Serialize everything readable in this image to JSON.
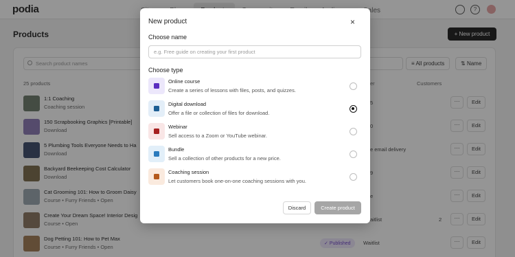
{
  "app": {
    "logo": "podia",
    "nav": [
      "Sites",
      "Plans",
      "Products",
      "Community",
      "Email",
      "Audience",
      "Sales"
    ]
  },
  "page": {
    "title": "Products",
    "new_product_label": "New product",
    "search_placeholder": "Search product names",
    "filter_all_label": "All products",
    "sort_label": "Name",
    "count_label": "25 products",
    "col_price_partial": "er",
    "col_customers": "Customers",
    "more_label": "···",
    "edit_label": "Edit",
    "published_label": "Published"
  },
  "products": [
    {
      "name": "1:1 Coaching",
      "sub": "Coaching session",
      "right": "5",
      "customers": ""
    },
    {
      "name": "150 Scrapbooking Graphics [Printable]",
      "sub": "Download",
      "right": "0",
      "customers": ""
    },
    {
      "name": "5 Plumbing Tools Everyone Needs to Ha",
      "sub": "Download",
      "right": "e email delivery",
      "customers": ""
    },
    {
      "name": "Backyard Beekeeping Cost Calculator",
      "sub": "Download",
      "right": "9",
      "customers": ""
    },
    {
      "name": "Cat Grooming 101: How to Groom Daisy",
      "sub": "Course • Furry Friends • Open",
      "right": "e",
      "customers": ""
    },
    {
      "name": "Create Your Dream Space! Interior Desig",
      "sub": "Course • Open",
      "right": "aitlist",
      "customers": "2"
    },
    {
      "name": "Dog Petting 101: How to Pet Max",
      "sub": "Course • Furry Friends • Open",
      "right": "Waitlist",
      "customers": ""
    }
  ],
  "modal": {
    "title": "New product",
    "close_glyph": "×",
    "choose_name_label": "Choose name",
    "name_placeholder": "e.g. Free guide on creating your first product",
    "choose_type_label": "Choose type",
    "options": [
      {
        "title": "Online course",
        "desc": "Create a series of lessons with files, posts, and quizzes.",
        "icon": "course-icon",
        "bg": "#ece7fb",
        "fg": "#5b2fc0",
        "selected": false
      },
      {
        "title": "Digital download",
        "desc": "Offer a file or collection of files for download.",
        "icon": "download-icon",
        "bg": "#e3eef8",
        "fg": "#1e5f94",
        "selected": true
      },
      {
        "title": "Webinar",
        "desc": "Sell access to a Zoom or YouTube webinar.",
        "icon": "webinar-icon",
        "bg": "#f9e6e6",
        "fg": "#a52121",
        "selected": false
      },
      {
        "title": "Bundle",
        "desc": "Sell a collection of other products for a new price.",
        "icon": "bundle-icon",
        "bg": "#e2eff9",
        "fg": "#2b7bbd",
        "selected": false
      },
      {
        "title": "Coaching session",
        "desc": "Let customers book one-on-one coaching sessions with you.",
        "icon": "coaching-icon",
        "bg": "#faeade",
        "fg": "#b45a1e",
        "selected": false
      }
    ],
    "discard_label": "Discard",
    "create_label": "Create product"
  }
}
